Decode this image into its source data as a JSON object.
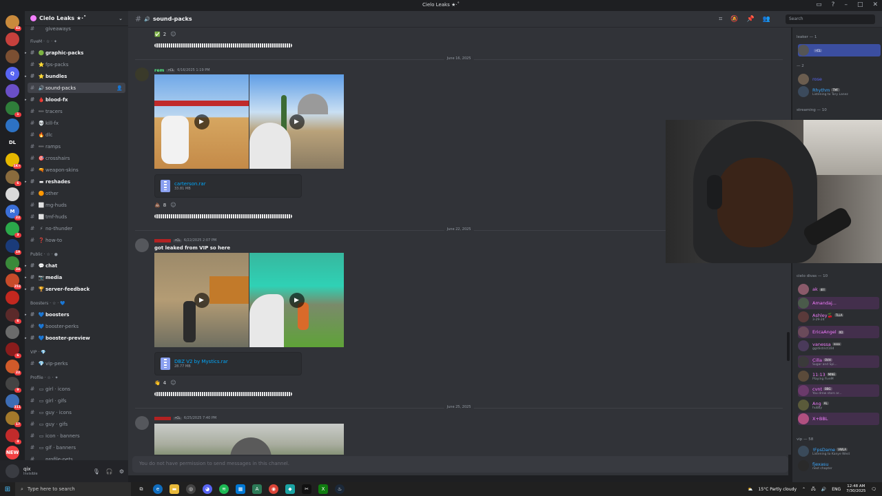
{
  "window": {
    "title": "Cielo Leaks ★·˚"
  },
  "server": {
    "name": "Cielo Leaks ★·˚"
  },
  "rail": {
    "servers": [
      {
        "label": "",
        "color": "#c98a3c",
        "badge": "42"
      },
      {
        "label": "",
        "color": "#c6403c",
        "badge": ""
      },
      {
        "label": "",
        "color": "#7b4f32",
        "badge": ""
      },
      {
        "label": "Q",
        "color": "#5865f2",
        "badge": ""
      },
      {
        "label": "",
        "color": "#6a4fc7",
        "badge": ""
      },
      {
        "label": "",
        "color": "#2f7d3a",
        "badge": "1"
      },
      {
        "label": "",
        "color": "#2d72c4",
        "badge": ""
      },
      {
        "label": "DL",
        "color": "#1e1f22",
        "badge": ""
      },
      {
        "label": "",
        "color": "#e6b800",
        "badge": "1K+"
      },
      {
        "label": "",
        "color": "#8a6b3d",
        "badge": "6"
      },
      {
        "label": "",
        "color": "#d9d9d9",
        "badge": ""
      },
      {
        "label": "M",
        "color": "#3b6fd8",
        "badge": "22"
      },
      {
        "label": "",
        "color": "#2ba84a",
        "badge": "3"
      },
      {
        "label": "",
        "color": "#1a3b7a",
        "badge": "19"
      },
      {
        "label": "",
        "color": "#3a8a3a",
        "badge": "34"
      },
      {
        "label": "",
        "color": "#c74b2a",
        "badge": "252"
      },
      {
        "label": "",
        "color": "#c2281f",
        "badge": ""
      },
      {
        "label": "",
        "color": "#5b2a2a",
        "badge": "6"
      },
      {
        "label": "",
        "color": "#6b6b6b",
        "badge": ""
      },
      {
        "label": "",
        "color": "#8a1c1c",
        "badge": "6"
      },
      {
        "label": "",
        "color": "#d05a2a",
        "badge": "22"
      },
      {
        "label": "",
        "color": "#444444",
        "badge": "9"
      },
      {
        "label": "",
        "color": "#3d6db5",
        "badge": "311"
      },
      {
        "label": "",
        "color": "#a3792b",
        "badge": "17"
      },
      {
        "label": "",
        "color": "#c22b2b",
        "badge": "4"
      },
      {
        "label": "NEW",
        "color": "#f23f42",
        "badge": ""
      }
    ]
  },
  "sidebar": {
    "top_partial": "giveaways",
    "categories": [
      {
        "label": "FiveM · ☆ · ✦"
      },
      {
        "label": "Public · ☆ · ●"
      },
      {
        "label": "Boosters · ☆ · 💙"
      },
      {
        "label": "VIP · 💎"
      },
      {
        "label": "Profile · ☆ · ✦"
      }
    ],
    "channels": [
      {
        "emoji": "🟢",
        "label": "graphic-packs",
        "unread": true,
        "arrow": true
      },
      {
        "emoji": "⭐",
        "label": "fps-packs",
        "unread": false,
        "arrow": false
      },
      {
        "emoji": "⭐",
        "label": "bundles",
        "unread": true,
        "arrow": true
      },
      {
        "emoji": "🔊",
        "label": "sound-packs",
        "unread": false,
        "arrow": false,
        "active": true
      },
      {
        "emoji": "🩸",
        "label": "blood-fx",
        "unread": true,
        "arrow": true
      },
      {
        "emoji": "➖",
        "label": "tracers",
        "unread": false,
        "arrow": false
      },
      {
        "emoji": "💀",
        "label": "kill-fx",
        "unread": false,
        "arrow": false
      },
      {
        "emoji": "🔥",
        "label": "dlc",
        "unread": false,
        "arrow": false
      },
      {
        "emoji": "➖",
        "label": "ramps",
        "unread": false,
        "arrow": false
      },
      {
        "emoji": "🎯",
        "label": "crosshairs",
        "unread": false,
        "arrow": false
      },
      {
        "emoji": "🔫",
        "label": "weapon-skins",
        "unread": false,
        "arrow": false
      },
      {
        "emoji": "▬",
        "label": "reshades",
        "unread": true,
        "arrow": true
      },
      {
        "emoji": "🟠",
        "label": "other",
        "unread": false,
        "arrow": false
      },
      {
        "emoji": "⬜",
        "label": "mg-huds",
        "unread": false,
        "arrow": false
      },
      {
        "emoji": "⬜",
        "label": "tmf-huds",
        "unread": false,
        "arrow": false
      },
      {
        "emoji": "⚡",
        "label": "no-thunder",
        "unread": false,
        "arrow": false
      },
      {
        "emoji": "❓",
        "label": "how-to",
        "unread": false,
        "arrow": false
      },
      {
        "emoji": "💬",
        "label": "chat",
        "unread": true,
        "arrow": true
      },
      {
        "emoji": "📷",
        "label": "media",
        "unread": true,
        "arrow": true
      },
      {
        "emoji": "🏆",
        "label": "server-feedback",
        "unread": true,
        "arrow": true
      },
      {
        "emoji": "💙",
        "label": "boosters",
        "unread": true,
        "arrow": true
      },
      {
        "emoji": "💙",
        "label": "booster-perks",
        "unread": false,
        "arrow": false
      },
      {
        "emoji": "💙",
        "label": "booster-preview",
        "unread": true,
        "arrow": true
      },
      {
        "emoji": "💎",
        "label": "vip-perks",
        "unread": false,
        "arrow": false
      },
      {
        "emoji": "▭",
        "label": "girl · icons",
        "unread": false,
        "arrow": false
      },
      {
        "emoji": "▭",
        "label": "girl · gifs",
        "unread": false,
        "arrow": false
      },
      {
        "emoji": "▭",
        "label": "guy · icons",
        "unread": false,
        "arrow": false
      },
      {
        "emoji": "▭",
        "label": "guy · gifs",
        "unread": false,
        "arrow": false
      },
      {
        "emoji": "▭",
        "label": "icon · banners",
        "unread": false,
        "arrow": false
      },
      {
        "emoji": "▭",
        "label": "gif · banners",
        "unread": false,
        "arrow": false
      },
      {
        "emoji": "",
        "label": "profile-pets",
        "unread": false,
        "arrow": false
      }
    ]
  },
  "user": {
    "name": "qix",
    "status": "Invisible"
  },
  "channel": {
    "name": "sound-packs",
    "search_placeholder": "Search"
  },
  "messages": {
    "top_reaction": {
      "emoji": "✅",
      "count": "2"
    },
    "dates": [
      "June 16, 2025",
      "June 22, 2025",
      "June 25, 2025"
    ],
    "posts": [
      {
        "author": "rem",
        "author_color": "#57f287",
        "tag": "⚡CL",
        "timestamp": "6/16/2025 1:19 PM",
        "text": "",
        "file": {
          "name": "carterson.rar",
          "size": "33.81 MB"
        },
        "reaction": {
          "emoji": "💩",
          "count": "8"
        }
      },
      {
        "author": "",
        "author_color": "#f23f42",
        "tag": "⚡CL",
        "timestamp": "6/22/2025 2:07 PM",
        "text": "got leaked from VIP so here",
        "file": {
          "name": "DBZ V2 by Mystics.rar",
          "size": "28.77 MB"
        },
        "reaction": {
          "emoji": "👋",
          "count": "4"
        }
      },
      {
        "author": "",
        "author_color": "#f23f42",
        "tag": "⚡CL",
        "timestamp": "6/25/2025 7:40 PM",
        "text": ""
      }
    ]
  },
  "input": {
    "placeholder": "You do not have permission to send messages in this channel."
  },
  "members": {
    "groups": [
      {
        "label": "leaker — 1"
      },
      {
        "label": "— 2"
      },
      {
        "label": "streaming — 10"
      },
      {
        "label": "cielo divas — 10"
      },
      {
        "label": "vip — 58"
      }
    ],
    "list": [
      {
        "name": "",
        "color": "#f23f42",
        "tag": "⚡CL",
        "status": ""
      },
      {
        "name": "rose",
        "color": "#5865f2",
        "tag": "",
        "status": ""
      },
      {
        "name": "Rhythm",
        "color": "#3ba9ff",
        "tag": "TMF",
        "status": "Listening to Tory Lanez"
      },
      {
        "name": "ak",
        "color": "#f47fff",
        "tag": "dill",
        "status": ""
      },
      {
        "name": "Amandaj...",
        "color": "#f47fff",
        "tag": "",
        "status": ""
      },
      {
        "name": "Ashley🍒",
        "color": "#f47fff",
        "tag": "TLLA",
        "status": "3-29-24"
      },
      {
        "name": "EricaAngel",
        "color": "#f47fff",
        "tag": "XO",
        "status": ""
      },
      {
        "name": "vanessa",
        "color": "#f47fff",
        "tag": "nssa",
        "status": "gg/district10d"
      },
      {
        "name": "Cilla",
        "color": "#f47fff",
        "tag": "OVH",
        "status": "Sugar and Spi..."
      },
      {
        "name": "11:13",
        "color": "#f47fff",
        "tag": "MINE",
        "status": "Playing FiveM"
      },
      {
        "name": "cvnt",
        "color": "#f47fff",
        "tag": "BBG",
        "status": "You drew stars ar..."
      },
      {
        "name": "Ang",
        "color": "#f47fff",
        "tag": "AL",
        "status": "hubby"
      },
      {
        "name": "X+BBL",
        "color": "#f47fff",
        "tag": "",
        "status": ""
      },
      {
        "name": "!FpsDame",
        "color": "#3ba9ff",
        "tag": "VWLA",
        "status": "Listening to Kanye West"
      },
      {
        "name": "fjexasu",
        "color": "#3ba9ff",
        "tag": "",
        "status": "next chapter"
      }
    ]
  },
  "taskbar": {
    "search_placeholder": "Type here to search",
    "weather": "15°C  Partly cloudy",
    "lang": "ENG",
    "time": "12:48 AM",
    "date": "7/30/2025"
  }
}
